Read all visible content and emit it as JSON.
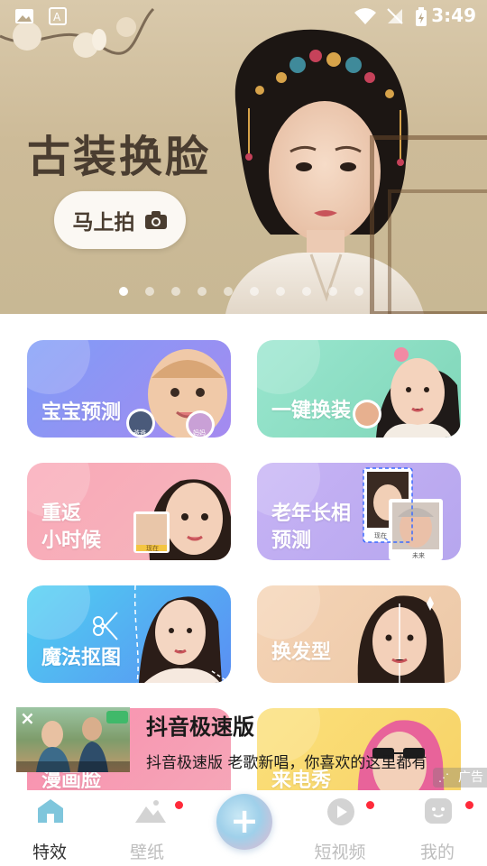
{
  "status_bar": {
    "time": "3:49"
  },
  "banner": {
    "title": "古装换脸",
    "cta_label": "马上拍",
    "pagination_count": 10,
    "active_index": 0
  },
  "features": [
    {
      "label": "宝宝预测",
      "badges": [
        "爸爸",
        "妈妈"
      ]
    },
    {
      "label": "一键换装"
    },
    {
      "label": "重返\n小时候",
      "badges": [
        "现在"
      ]
    },
    {
      "label": "老年长相\n预测",
      "badges": [
        "现在",
        "未来"
      ]
    },
    {
      "label": "魔法抠图"
    },
    {
      "label": "换发型"
    },
    {
      "label": "漫画脸"
    },
    {
      "label": "来电秀"
    }
  ],
  "ad": {
    "title": "抖音极速版",
    "description": "抖音极速版 老歌新唱，你喜欢的这里都有",
    "tag": "广告",
    "close_icon": "×"
  },
  "nav": {
    "items": [
      {
        "label": "特效",
        "icon": "home-icon",
        "active": true
      },
      {
        "label": "壁纸",
        "icon": "mountain-icon",
        "badge": true
      },
      {
        "label": "短视频",
        "icon": "play-icon",
        "badge": true
      },
      {
        "label": "我的",
        "icon": "face-icon",
        "badge": true
      }
    ],
    "plus_label": "+"
  },
  "colors": {
    "accent_red": "#ff2a3a",
    "card_baby": "#8f8cf5",
    "card_outfit": "#8fdcc0",
    "card_child": "#f6a9b5",
    "card_elder": "#b8a8f0",
    "card_cutout": "#5ab7f5",
    "card_hair": "#efc9a4",
    "card_comic": "#f38ea8",
    "card_call": "#f8d86e"
  }
}
